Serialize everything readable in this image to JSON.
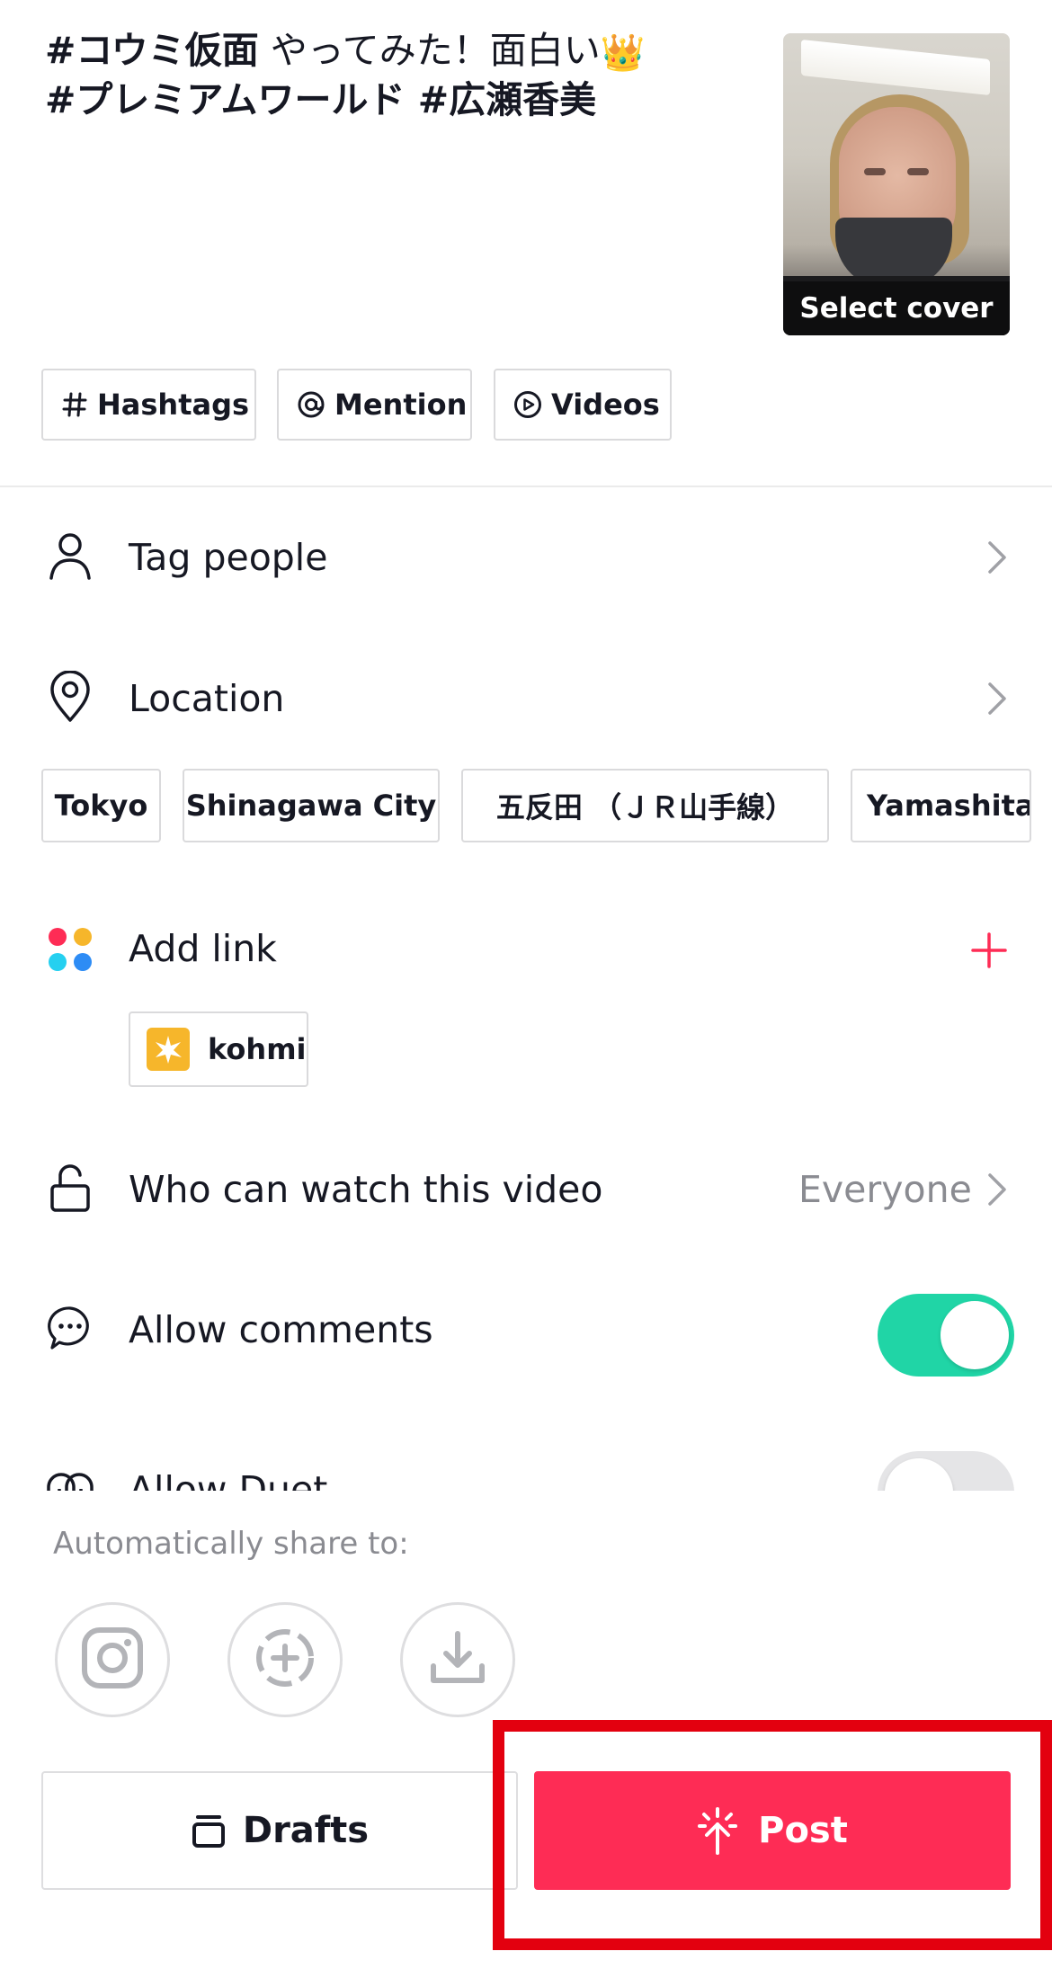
{
  "caption": {
    "line1_bold": "#コウミ仮面",
    "line1_text": " やってみた！面白い",
    "line1_emoji": "👑",
    "line2_bold": "#プレミアムワールド #広瀬香美"
  },
  "cover": {
    "label": "Select cover"
  },
  "chips": [
    {
      "label": "Hashtags",
      "icon": "hash-icon"
    },
    {
      "label": "Mention",
      "icon": "at-icon"
    },
    {
      "label": "Videos",
      "icon": "play-circle-icon"
    }
  ],
  "rows": {
    "tag_people": "Tag people",
    "location": "Location",
    "add_link": "Add link",
    "who_can_watch": "Who can watch this video",
    "who_can_watch_value": "Everyone",
    "allow_comments": "Allow comments",
    "allow_duet": "Allow Duet"
  },
  "location_suggestions": [
    "Tokyo",
    "Shinagawa City",
    "五反田 （ＪＲ山手線）",
    "Yamashita"
  ],
  "link": {
    "label": "kohmi"
  },
  "toggles": {
    "allow_comments": true,
    "allow_duet": false
  },
  "share": {
    "label": "Automatically share to:",
    "targets": [
      "instagram-icon",
      "story-add-icon",
      "download-icon"
    ]
  },
  "actions": {
    "drafts": "Drafts",
    "post": "Post"
  },
  "colors": {
    "accent": "#fe2c55",
    "toggle_on": "#20d5a6",
    "highlight": "#e3000f"
  }
}
